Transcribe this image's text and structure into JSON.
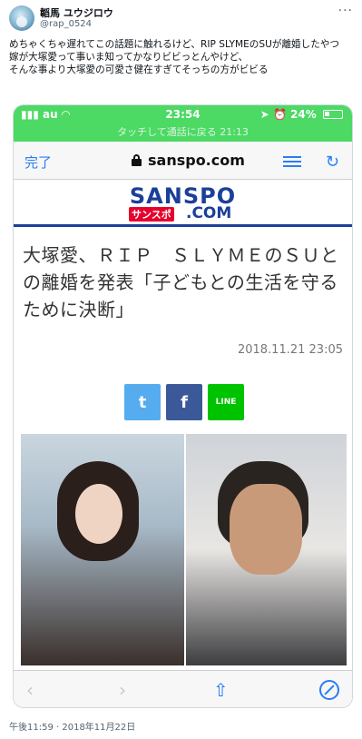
{
  "tweet": {
    "display_name": "韜馬 ユウジロウ",
    "handle": "@rap_0524",
    "more_label": "···",
    "lines": [
      "めちゃくちゃ遅れてこの話題に触れるけど、RIP SLYMEのSUが離婚したやつ",
      "嫁が大塚愛って事いま知ってかなりビビっとんやけど、",
      "そんな事より大塚愛の可愛さ健在すぎてそっちの方がビビる"
    ],
    "timestamp": "午後11:59 · 2018年11月22日"
  },
  "screenshot": {
    "status_bar": {
      "carrier": "au",
      "time": "23:54",
      "battery": "24%",
      "return_text": "タッチして通話に戻る 21:13",
      "color": "#4cd964"
    },
    "url_bar": {
      "done_label": "完了",
      "domain": "sanspo.com"
    },
    "site_logo": {
      "main": "SANSPO",
      "sub": "サンスポ",
      "com": ".COM"
    },
    "article": {
      "headline": "大塚愛、ＲＩＰ　ＳＬＹＭＥのＳＵとの離婚を発表「子どもとの生活を守るために決断」",
      "date": "2018.11.21 23:05",
      "share_twitter": "t",
      "share_facebook": "f",
      "share_line": "LINE"
    },
    "toolbar": {
      "back": "‹",
      "forward": "›",
      "share": "⇧"
    }
  },
  "colors": {
    "accent": "#2a7df5",
    "brand": "#1b3f9a",
    "brand_red": "#e6002d"
  }
}
